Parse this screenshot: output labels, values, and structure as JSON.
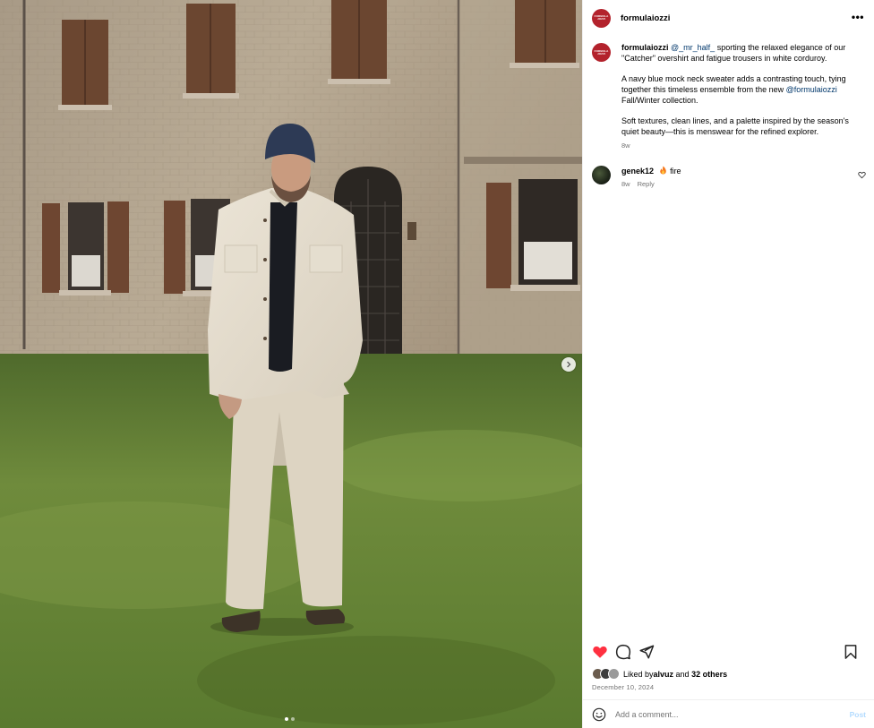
{
  "post": {
    "author": "formulaiozzi",
    "avatar_text": "FORMULA JOZZI",
    "more_icon": "more-horizontal-icon",
    "caption": {
      "username": "formulaiozzi",
      "mention1": "@_mr_half_",
      "part1": " sporting the relaxed elegance of our \"Catcher\" overshirt and fatigue trousers in white corduroy.",
      "part2": "A navy blue mock neck sweater adds a contrasting touch, tying together this timeless ensemble from the new ",
      "mention2": "@formulaiozzi",
      "part2_end": " Fall/Winter collection.",
      "part3": "Soft textures, clean lines, and a palette inspired by the season's quiet beauty—this is menswear for the refined explorer.",
      "time": "8w"
    },
    "comments": [
      {
        "username": "genek12",
        "text": "fire",
        "emoji": "fire-icon",
        "time": "8w",
        "reply_label": "Reply"
      }
    ],
    "likes": {
      "prefix": "Liked by ",
      "user": "alvuz",
      "and": " and ",
      "others": "32 others"
    },
    "date": "December 10, 2024",
    "add_comment": {
      "placeholder": "Add a comment...",
      "post_label": "Post"
    },
    "carousel": {
      "slide": 1,
      "slides": 2
    }
  },
  "colors": {
    "brand": "#b3222c",
    "like_red": "#ff3040",
    "link": "#00376b",
    "post_disabled": "#b3dbff"
  }
}
